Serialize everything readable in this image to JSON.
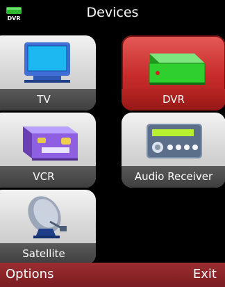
{
  "header": {
    "title": "Devices",
    "badge_text": "DVR"
  },
  "tiles": [
    {
      "label": "TV",
      "icon": "tv-icon"
    },
    {
      "label": "DVR",
      "icon": "dvr-icon",
      "selected": true
    },
    {
      "label": "VCR",
      "icon": "vcr-icon"
    },
    {
      "label": "Audio Receiver",
      "icon": "audio-receiver-icon"
    },
    {
      "label": "Satellite",
      "icon": "satellite-dish-icon"
    }
  ],
  "softkeys": {
    "left": "Options",
    "right": "Exit"
  },
  "colors": {
    "accent": "#c62b2a",
    "softbar": "#8a2428",
    "dvr_green": "#32c832"
  }
}
